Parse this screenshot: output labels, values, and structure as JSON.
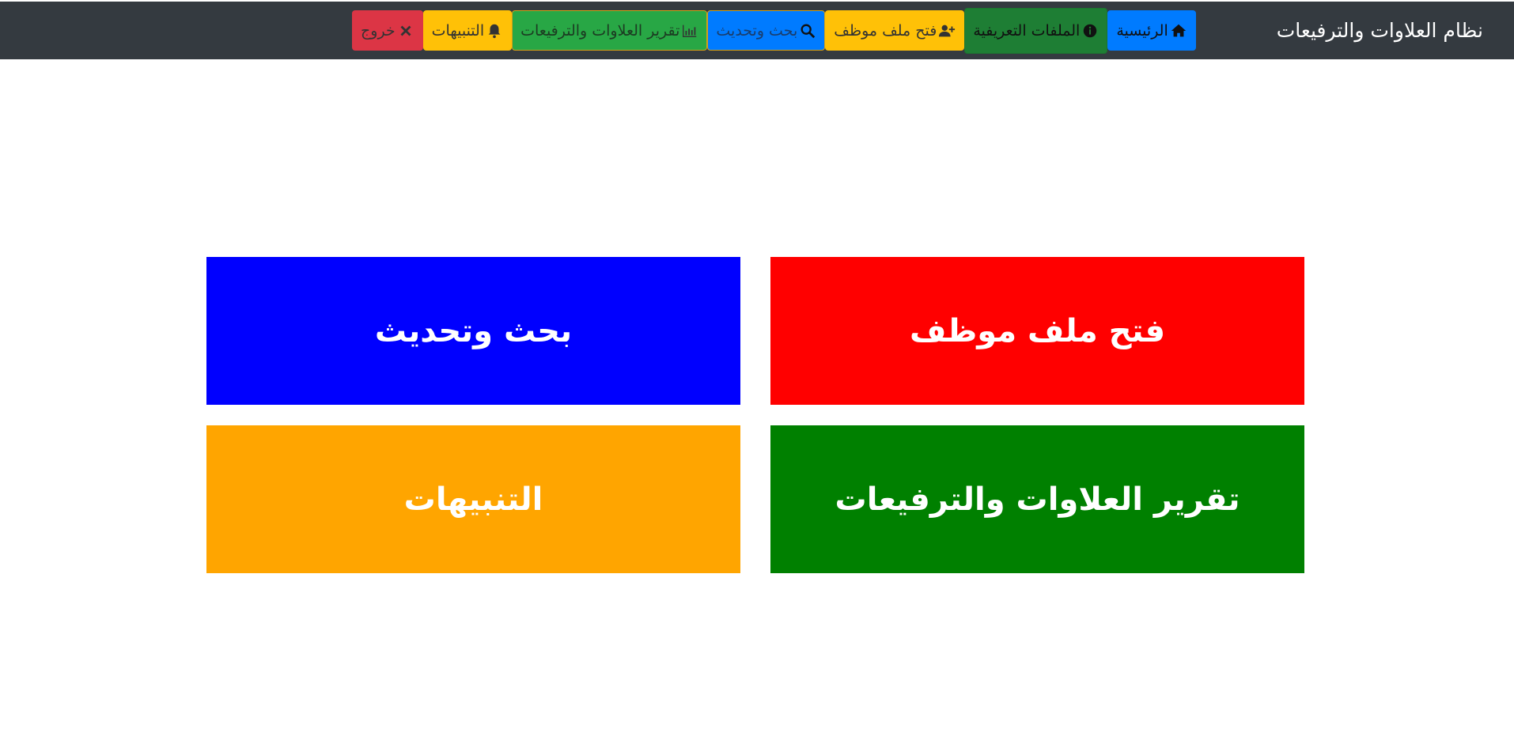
{
  "navbar": {
    "brand": "نظام العلاوات والترفيعات",
    "items": [
      {
        "label": "الرئيسية",
        "icon": "home-icon",
        "color": "#007bff"
      },
      {
        "label": "الملفات التعريفية",
        "icon": "info-circle-icon",
        "color": "#1e7e34"
      },
      {
        "label": "فتح ملف موظف",
        "icon": "user-plus-icon",
        "color": "#ffc107"
      },
      {
        "label": "بحث وتحديث",
        "icon": "search-icon",
        "color": "#007bff"
      },
      {
        "label": "تقرير العلاوات والترفيعات",
        "icon": "chart-icon",
        "color": "#28a745"
      },
      {
        "label": "التنبيهات",
        "icon": "bell-icon",
        "color": "#ffc107"
      },
      {
        "label": "خروج",
        "icon": "close-icon",
        "color": "#dc3545"
      }
    ]
  },
  "tiles": [
    {
      "label": "فتح ملف موظف",
      "color": "#ff0000"
    },
    {
      "label": "بحث وتحديث",
      "color": "#0000ff"
    },
    {
      "label": "تقرير العلاوات والترفيعات",
      "color": "#008000"
    },
    {
      "label": "التنبيهات",
      "color": "#ffa500"
    }
  ]
}
